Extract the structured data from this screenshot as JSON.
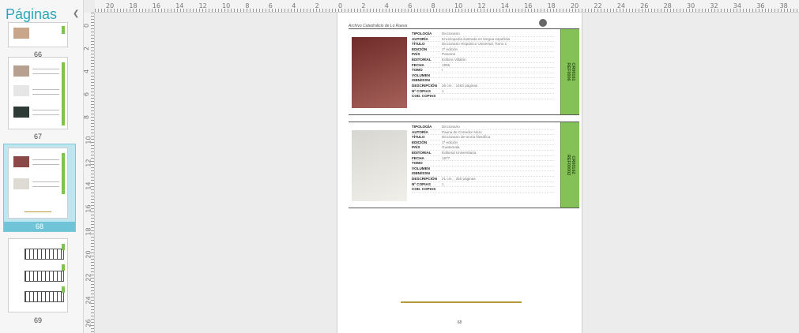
{
  "sidebar": {
    "title": "Páginas",
    "collapse_icon": "chevron-left-icon",
    "thumbnails": [
      {
        "label": "66"
      },
      {
        "label": "67"
      },
      {
        "label": "68",
        "selected": true
      },
      {
        "label": "69"
      }
    ]
  },
  "ruler": {
    "horizontal": [
      "20",
      "18",
      "16",
      "14",
      "12",
      "10",
      "8",
      "6",
      "4",
      "2",
      "0",
      "2",
      "4",
      "6",
      "8",
      "10",
      "12",
      "14",
      "16",
      "18",
      "20",
      "22",
      "24",
      "26",
      "28",
      "30",
      "32",
      "34",
      "36",
      "38",
      "40"
    ],
    "vertical": [
      "0",
      "2",
      "4",
      "6",
      "8",
      "10",
      "12",
      "14",
      "16",
      "18",
      "20",
      "22",
      "24",
      "26"
    ]
  },
  "page": {
    "header": "Archivo Catedralicio de Lo Rueva",
    "logo_icon": "seal-icon",
    "page_number": "68",
    "accent_color": "#84c257",
    "records": [
      {
        "tag": "CR00161\nREF0006",
        "photo_colors": [
          "#6e2b28",
          "#a6615a"
        ],
        "fields": [
          {
            "key": "TIPOLOGÍA",
            "val": "Diccionario"
          },
          {
            "key": "AUTORÍA",
            "val": "Enciclopedia ilustrada en lengua española"
          },
          {
            "key": "TÍTULO",
            "val": "Diccionario Hispánico Universal, Tomo 1"
          },
          {
            "key": "EDICIÓN",
            "val": "1ª edición"
          },
          {
            "key": "PAÍS",
            "val": "Panamá"
          },
          {
            "key": "EDITORIAL",
            "val": "Editora Villalón"
          },
          {
            "key": "FECHA",
            "val": "1955"
          },
          {
            "key": "TOMO",
            "val": "I"
          },
          {
            "key": "VOLUMEN",
            "val": ""
          },
          {
            "key": "ISBN/ISSN",
            "val": ""
          },
          {
            "key": "DESCRIPCIÓN",
            "val": "26 cm. ; 1463 páginas"
          },
          {
            "key": "Nº COPIAS",
            "val": "1"
          },
          {
            "key": "COD. COPIAS",
            "val": ""
          }
        ]
      },
      {
        "tag": "CR00162\nREF00002",
        "photo_colors": [
          "#d8d6d0",
          "#f1efea"
        ],
        "fields": [
          {
            "key": "TIPOLOGÍA",
            "val": "Diccionario"
          },
          {
            "key": "AUTORÍA",
            "val": "Pauna de Corredor Nicio"
          },
          {
            "key": "TÍTULO",
            "val": "Diccionario de teoría filosófica"
          },
          {
            "key": "EDICIÓN",
            "val": "1ª edición"
          },
          {
            "key": "PAÍS",
            "val": "Guatemala"
          },
          {
            "key": "EDITORIAL",
            "val": "Editorial Universitaria"
          },
          {
            "key": "FECHA",
            "val": "1977"
          },
          {
            "key": "TOMO",
            "val": ""
          },
          {
            "key": "VOLUMEN",
            "val": ""
          },
          {
            "key": "ISBN/ISSN",
            "val": ""
          },
          {
            "key": "DESCRIPCIÓN",
            "val": "21 cm. ; 250 páginas"
          },
          {
            "key": "Nº COPIAS",
            "val": "1"
          },
          {
            "key": "COD. COPIAS",
            "val": ""
          }
        ]
      }
    ]
  }
}
